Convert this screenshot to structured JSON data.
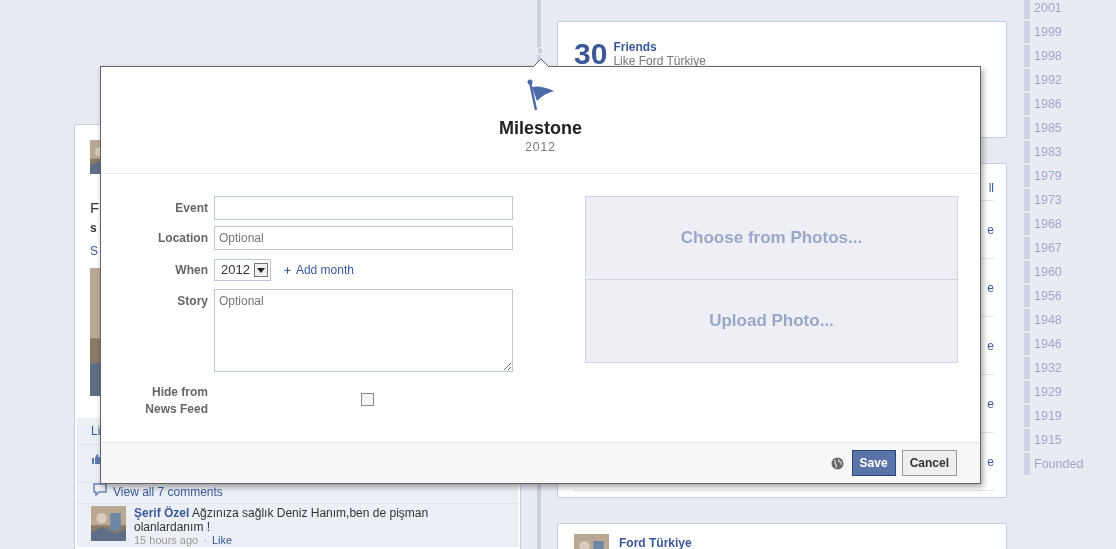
{
  "timeline_years": [
    "2001",
    "1999",
    "1998",
    "1992",
    "1986",
    "1985",
    "1983",
    "1979",
    "1973",
    "1968",
    "1967",
    "1960",
    "1956",
    "1948",
    "1946",
    "1932",
    "1929",
    "1919",
    "1915",
    "Founded"
  ],
  "left_card": {
    "text_fragment": "F",
    "text_fragment_2": "s",
    "link_fragment": "S",
    "action_fragment": "Li",
    "comments_link": "View all 7 comments",
    "comment": {
      "author": "Şerif Özel",
      "text": "Ağzınıza sağlık Deniz Hanım,ben de pişman olanlardanım !",
      "time": "15 hours ago",
      "separator": "·",
      "like": "Like"
    }
  },
  "friends_card": {
    "count": "30",
    "title": "Friends",
    "subtitle": "Like Ford Türkiye"
  },
  "right_card": {
    "header_link": "ll",
    "row_links": [
      "e",
      "e",
      "e",
      "e",
      "e"
    ]
  },
  "bottom_card": {
    "title": "Ford Türkiye"
  },
  "dialog": {
    "title": "Milestone",
    "year": "2012",
    "fields": [
      {
        "kind": "text",
        "label": "Event"
      },
      {
        "kind": "text",
        "label": "Location",
        "placeholder": "Optional"
      },
      {
        "kind": "select",
        "label": "When",
        "value": "2012",
        "link": "Add month"
      },
      {
        "kind": "textarea",
        "label": "Story",
        "placeholder": "Optional"
      },
      {
        "kind": "checkbox",
        "label": "Hide from News Feed",
        "checked": false
      }
    ],
    "photo_options": [
      "Choose from Photos...",
      "Upload Photo..."
    ],
    "save": "Save",
    "cancel": "Cancel"
  }
}
